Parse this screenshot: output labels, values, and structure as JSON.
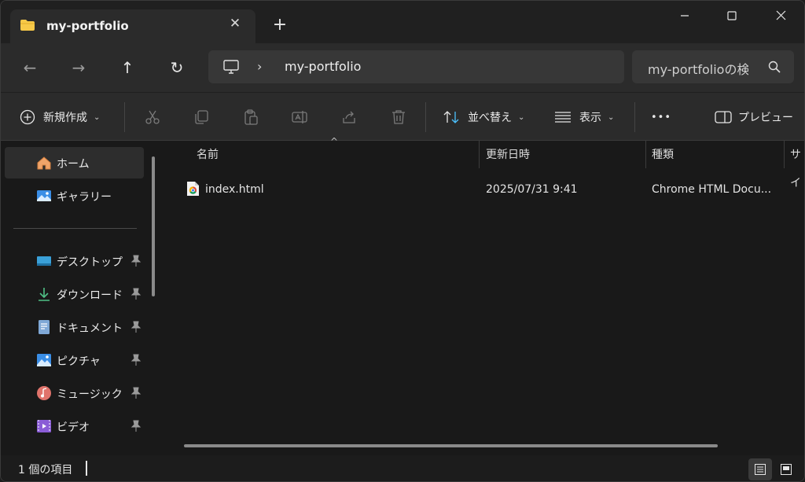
{
  "tab": {
    "title": "my-portfolio",
    "close_glyph": "✕",
    "new_tab_glyph": "+"
  },
  "window_controls": {
    "minimize": "—",
    "maximize": "☐",
    "close": "✕"
  },
  "nav": {
    "back": "←",
    "forward": "→",
    "up": "↑",
    "refresh": "↻"
  },
  "address": {
    "separator": "›",
    "crumb": "my-portfolio"
  },
  "search": {
    "placeholder": "my-portfolioの検索"
  },
  "commands": {
    "new": "新規作成",
    "sort": "並べ替え",
    "view": "表示",
    "more": "•••",
    "preview": "プレビュー"
  },
  "sidebar": {
    "items": [
      {
        "label": "ホーム",
        "icon": "home-icon"
      },
      {
        "label": "ギャラリー",
        "icon": "gallery-icon"
      },
      {
        "label": "デスクトップ",
        "icon": "desktop-icon",
        "pinned": true
      },
      {
        "label": "ダウンロード",
        "icon": "download-icon",
        "pinned": true
      },
      {
        "label": "ドキュメント",
        "icon": "documents-icon",
        "pinned": true
      },
      {
        "label": "ピクチャ",
        "icon": "pictures-icon",
        "pinned": true
      },
      {
        "label": "ミュージック",
        "icon": "music-icon",
        "pinned": true
      },
      {
        "label": "ビデオ",
        "icon": "video-icon",
        "pinned": true
      }
    ]
  },
  "table": {
    "columns": [
      "名前",
      "更新日時",
      "種類",
      "サイ"
    ],
    "rows": [
      {
        "name": "index.html",
        "modified": "2025/07/31 9:41",
        "type": "Chrome HTML Docu..."
      }
    ]
  },
  "status": {
    "count": "1 個の項目"
  },
  "colors": {
    "background": "#191919",
    "toolbar": "#2b2b2b",
    "folder": "#f7c948",
    "accent": "#4cc2ff"
  }
}
